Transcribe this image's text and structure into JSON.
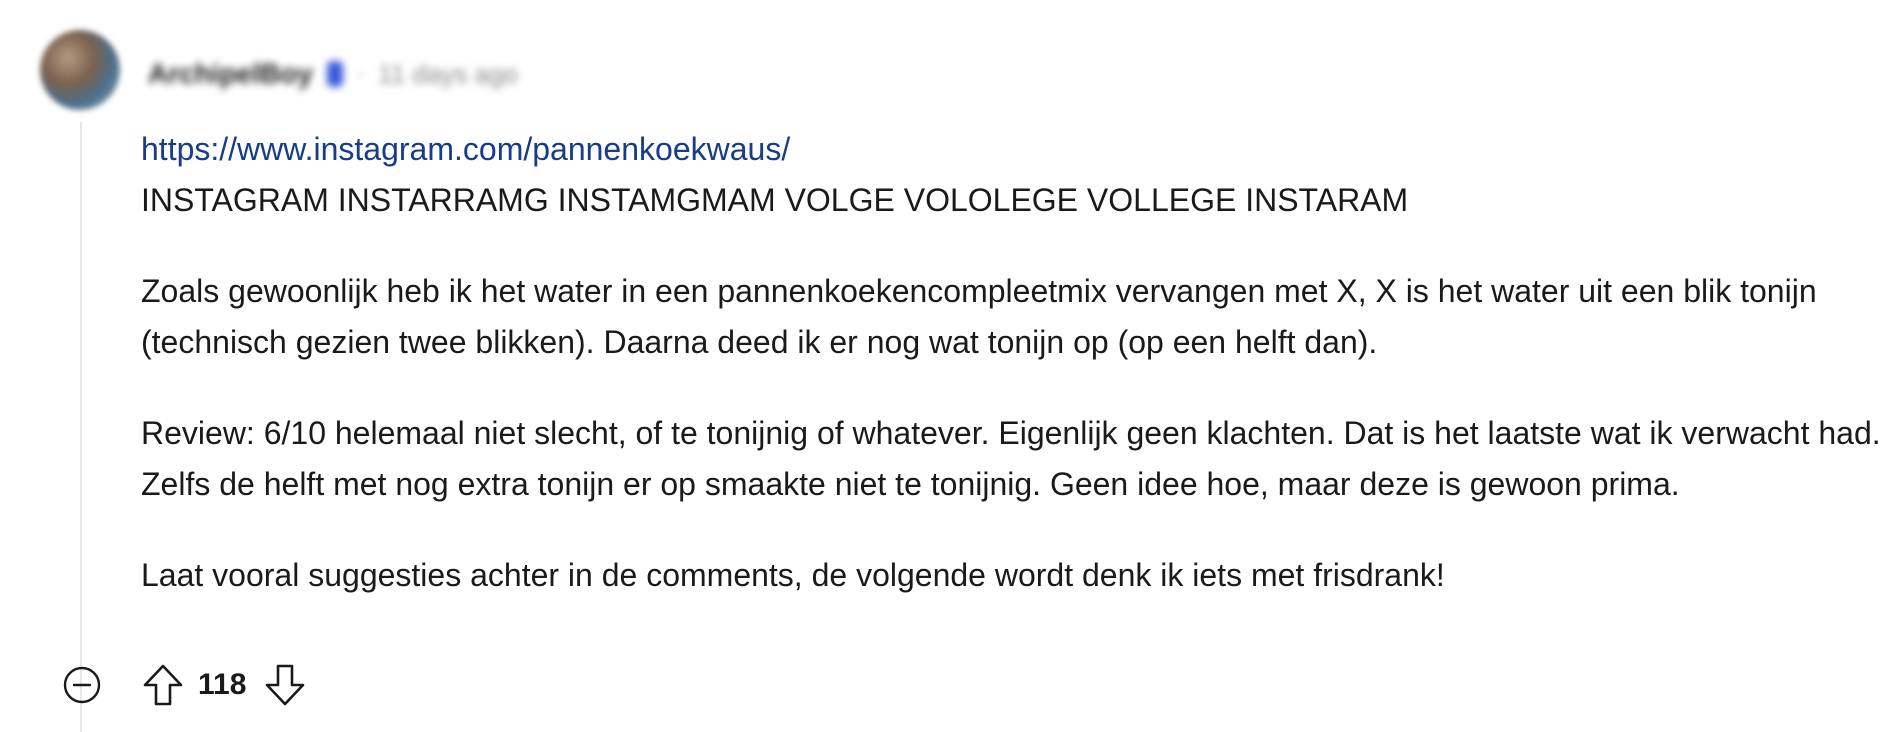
{
  "comment": {
    "author": "ArchipelBoy",
    "time_ago": "11 days ago",
    "separator": "·",
    "link_text": "https://www.instagram.com/pannenkoekwaus/",
    "lines": {
      "shout": "INSTAGRAM INSTARRAMG INSTAMGMAM VOLGE VOLOLEGE VOLLEGE INSTARAM",
      "para1": "Zoals gewoonlijk heb ik het water in een pannenkoekencompleetmix vervangen met X, X is het water uit een blik tonijn (technisch gezien twee blikken). Daarna deed ik er nog wat tonijn op (op een helft dan).",
      "para2": "Review: 6/10 helemaal niet slecht, of te tonijnig of whatever. Eigenlijk geen klachten. Dat is het laatste wat ik verwacht had. Zelfs de helft met nog extra tonijn er op smaakte niet te tonijnig. Geen idee hoe, maar deze is gewoon prima.",
      "para3": "Laat vooral suggesties achter in de comments, de volgende wordt denk ik iets met frisdrank!"
    },
    "score": "118",
    "icons": {
      "collapse": "collapse-minus-icon",
      "upvote": "upvote-arrow-icon",
      "downvote": "downvote-arrow-icon"
    }
  },
  "colors": {
    "link": "#163c8c",
    "text": "#1a1a1b",
    "thread_line": "#e6e7e8",
    "badge": "#3a5bd8"
  }
}
